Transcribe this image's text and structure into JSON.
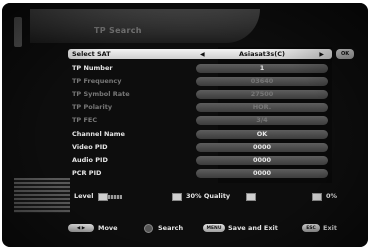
{
  "menu": {
    "title": "TP Search",
    "ok_label": "OK",
    "rows": [
      {
        "label": "Select SAT",
        "value": "Asiasat3s(C)",
        "selected": true,
        "dim": false
      },
      {
        "label": "TP Number",
        "value": "1",
        "selected": false,
        "dim": false
      },
      {
        "label": "TP Frequency",
        "value": "03640",
        "selected": false,
        "dim": true
      },
      {
        "label": "TP Symbol Rate",
        "value": "27500",
        "selected": false,
        "dim": true
      },
      {
        "label": "TP Polarity",
        "value": "HOR.",
        "selected": false,
        "dim": true
      },
      {
        "label": "TP FEC",
        "value": "3/4",
        "selected": false,
        "dim": true
      },
      {
        "label": "Channel Name",
        "value": "OK",
        "selected": false,
        "dim": false
      },
      {
        "label": "Video PID",
        "value": "0000",
        "selected": false,
        "dim": false
      },
      {
        "label": "Audio PID",
        "value": "0000",
        "selected": false,
        "dim": false
      },
      {
        "label": "PCR PID",
        "value": "0000",
        "selected": false,
        "dim": false
      }
    ]
  },
  "signal": {
    "level_label": "Level",
    "quality_text": "30% Quality",
    "level_percent": "0%"
  },
  "help": {
    "move_label": "Move",
    "search_label": "Search",
    "menu_key": "MENU",
    "save_label": "Save and Exit",
    "esc_key": "ESC",
    "exit_label": "Exit"
  }
}
